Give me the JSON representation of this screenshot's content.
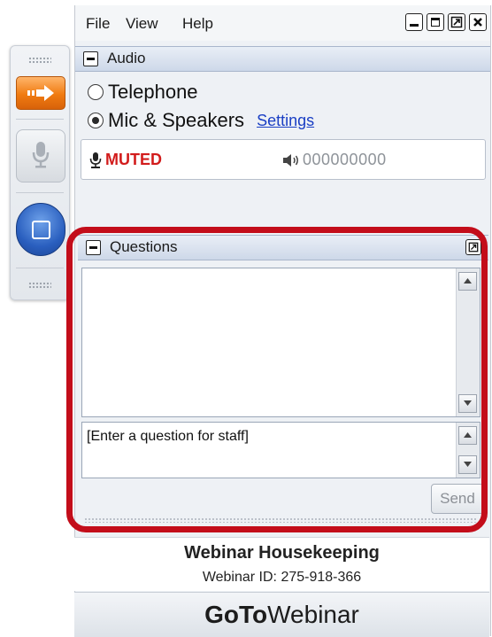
{
  "menu": {
    "file": "File",
    "view": "View",
    "help": "Help"
  },
  "audio": {
    "title": "Audio",
    "option_telephone": "Telephone",
    "option_mic": "Mic & Speakers",
    "selected": "Mic & Speakers",
    "settings_link": "Settings",
    "mic_status": "MUTED",
    "speaker_level": "000000000"
  },
  "questions": {
    "title": "Questions",
    "input_value": "[Enter a question for staff]",
    "send_label": "Send"
  },
  "footer": {
    "title": "Webinar Housekeeping",
    "webinar_id": "Webinar ID: 275-918-366",
    "brand_bold": "GoTo",
    "brand_rest": "Webinar"
  },
  "colors": {
    "accent_orange": "#f07b11",
    "muted_red": "#d21c1c",
    "highlight_frame": "#c30d1a",
    "link_blue": "#1a3fc4",
    "screen_button_blue": "#2a5fbf"
  },
  "icons": [
    "arrow-right-icon",
    "microphone-icon",
    "stop-screen-icon",
    "speaker-icon",
    "minimize-icon",
    "maximize-icon",
    "restore-icon",
    "close-icon",
    "popout-icon"
  ]
}
